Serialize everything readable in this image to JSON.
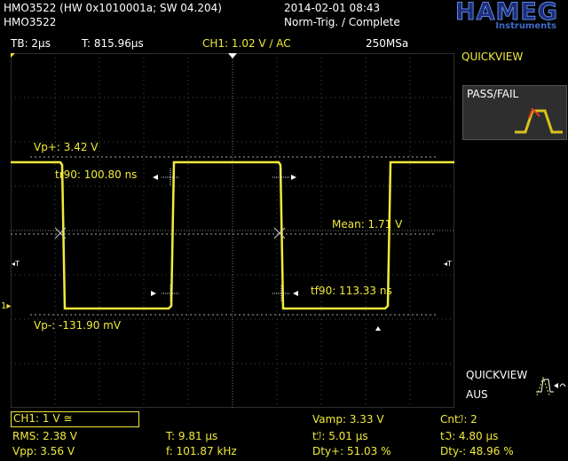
{
  "header": {
    "device_info": "HMO3522 (HW 0x1010001a; SW 04.204)",
    "device_name": "HMO3522",
    "datetime": "2014-02-01 08:43",
    "trigger_status": "Norm-Trig. / Complete",
    "logo_brand": "HAMEG",
    "logo_sub": "Instruments"
  },
  "status_bar": {
    "timebase": "TB: 2µs",
    "trigger_time": "T: 815.96µs",
    "channel": "CH1: 1.02 V ∕ AC",
    "sample_rate": "250MSa"
  },
  "side_panel": {
    "quickview_title": "QUICKVIEW",
    "passfail_label": "PASS/FAIL",
    "quickview_bottom": "QUICKVIEW",
    "aus_label": "AUS"
  },
  "measurements_overlay": {
    "vp_plus": "Vp+: 3.42 V",
    "tr90": "tr90: 100.80 ns",
    "mean": "Mean: 1.71 V",
    "tf90": "tf90: 113.33 ns",
    "vp_minus": "Vp-: -131.90 mV"
  },
  "markers": {
    "trigger_left": "T",
    "trigger_right": "T",
    "ground_ref": "1"
  },
  "bottom_panel": {
    "ch1_scale": "CH1: 1 V ≅",
    "vamp": "Vamp: 3.33 V",
    "cnt": "Cntℐ: 2",
    "rms": "RMS: 2.38 V",
    "period": "T: 9.81 µs",
    "t_rise_pulse": "tℐ: 5.01 µs",
    "t_fall_pulse": "tℑ: 4.80 µs",
    "vpp": "Vpp: 3.56 V",
    "frequency": "f: 101.87 kHz",
    "duty_plus": "Dty+: 51.03 %",
    "duty_minus": "Dty-: 48.96 %"
  },
  "colors": {
    "trace": "#f2ea3a",
    "text": "#ffffff",
    "background": "#000000",
    "grid": "#5a5a5a",
    "logo": "#1f2c7a"
  }
}
